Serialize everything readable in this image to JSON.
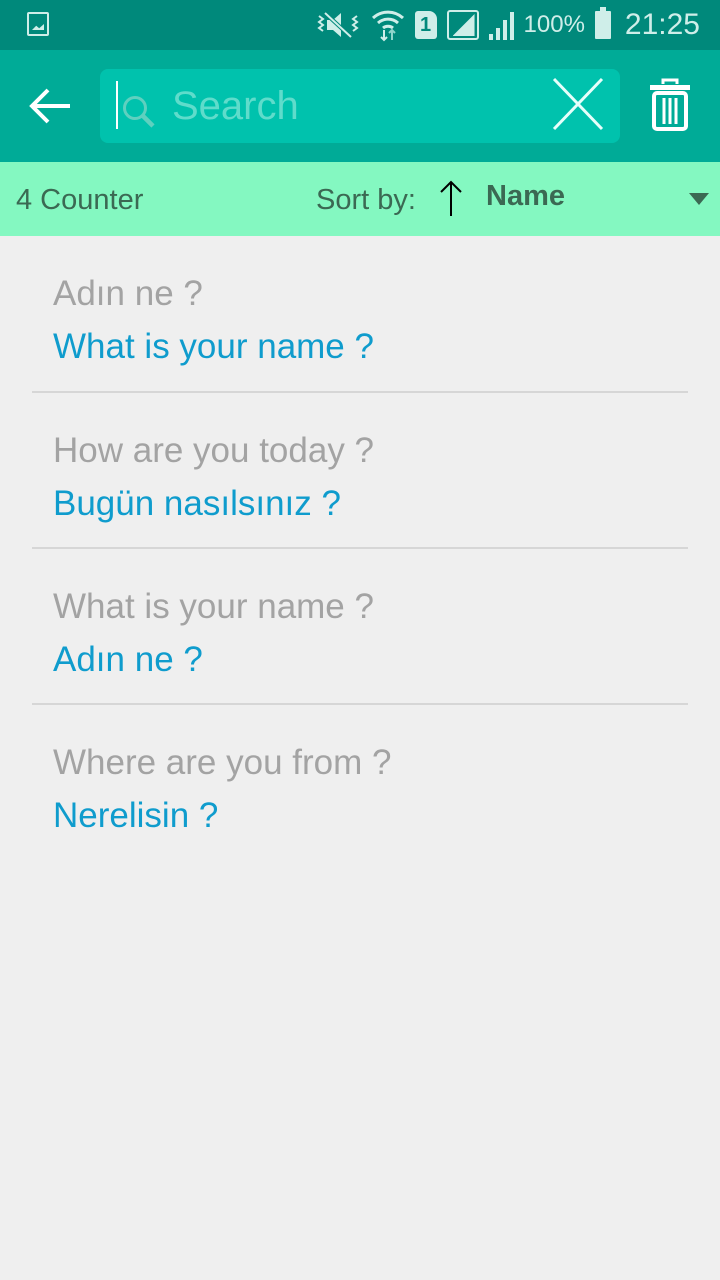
{
  "status_bar": {
    "battery_percent": "100%",
    "time": "21:25",
    "sim_slot": "1",
    "icons": [
      "gallery-notification-icon",
      "vibrate-mute-icon",
      "wifi-icon",
      "sim-icon",
      "signal-box-icon",
      "signal-bars-icon",
      "battery-icon"
    ]
  },
  "toolbar": {
    "back_icon": "arrow-left-icon",
    "search": {
      "placeholder": "Search",
      "value": "",
      "search_icon": "magnifier-icon",
      "clear_icon": "close-x-icon"
    },
    "delete_icon": "trash-icon"
  },
  "sort_bar": {
    "count_label": "4 Counter",
    "sort_label": "Sort by:",
    "sort_direction": "ascending",
    "sort_value": "Name",
    "colors": {
      "background": "#84f8c1",
      "text": "#3b6953"
    }
  },
  "items": [
    {
      "source": "Adın ne ?",
      "translation": "What is your name ?"
    },
    {
      "source": "How are you today ?",
      "translation": "Bugün nasılsınız ?"
    },
    {
      "source": "What is your name ?",
      "translation": "Adın ne ?"
    },
    {
      "source": "Where are you from ?",
      "translation": "Nerelisin ?"
    }
  ],
  "colors": {
    "status_bar": "#00897b",
    "toolbar": "#00ab97",
    "search_field": "#00c2ad",
    "source_text": "#a3a3a3",
    "translation_text": "#0f9ccd",
    "background": "#efefef"
  }
}
